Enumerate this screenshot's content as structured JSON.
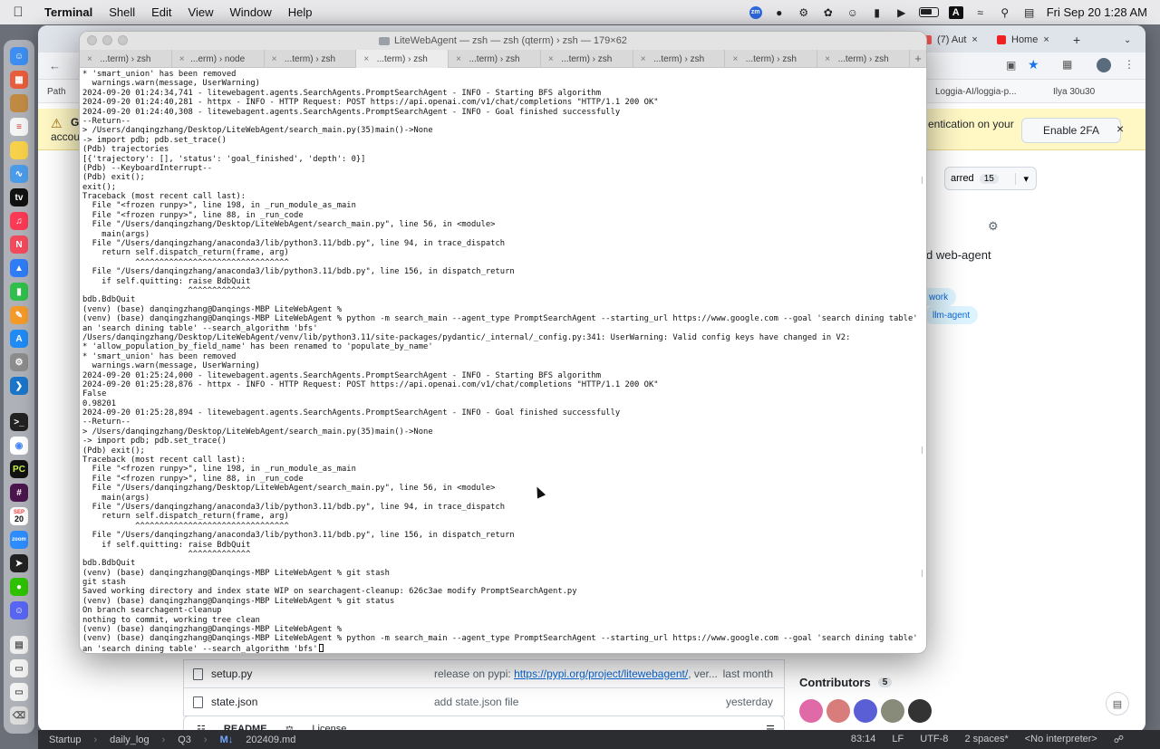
{
  "menubar": {
    "app_name": "Terminal",
    "items": [
      "Shell",
      "Edit",
      "View",
      "Window",
      "Help"
    ],
    "clock": "Fri Sep 20  1:28 AM",
    "tray_badge": "zm",
    "tray_letter": "A"
  },
  "dock": {
    "calendar_month": "SEP",
    "calendar_day": "20"
  },
  "browser": {
    "tabs": [
      {
        "label": "(7) Aut"
      },
      {
        "label": "Home"
      }
    ],
    "bookmarks": {
      "left": "Path",
      "loggia": "Loggia-AI/loggia-p...",
      "ilya": "Ilya 30u30"
    },
    "banner": {
      "partial_title": "G",
      "partial_sub": "accou",
      "partial_text": "entication on your",
      "button": "Enable 2FA"
    },
    "repo": {
      "starred_label": "arred",
      "starred_count": "15",
      "about_partial": "d web-agent",
      "topics": [
        "work",
        "llm-agent"
      ]
    },
    "files": [
      {
        "name": "setup.py",
        "message": "release on pypi: ",
        "link": "https://pypi.org/project/litewebagent/",
        "suffix": ", ver...",
        "date": "last month"
      },
      {
        "name": "state.json",
        "message": "add state.json file",
        "link": "",
        "suffix": "",
        "date": "yesterday"
      }
    ],
    "readme_tab": "README",
    "license_tab": "License",
    "contributors_label": "Contributors",
    "contributors_count": "5"
  },
  "terminal": {
    "title": "LiteWebAgent — zsh — zsh (qterm) › zsh — 179×62",
    "tabs": [
      {
        "label": "...term) › zsh",
        "active": false
      },
      {
        "label": "...erm) › node",
        "active": false
      },
      {
        "label": "...term) › zsh",
        "active": false
      },
      {
        "label": "...term) › zsh",
        "active": true
      },
      {
        "label": "...term) › zsh",
        "active": false
      },
      {
        "label": "...term) › zsh",
        "active": false
      },
      {
        "label": "...term) › zsh",
        "active": false
      },
      {
        "label": "...term) › zsh",
        "active": false
      },
      {
        "label": "...term) › zsh",
        "active": false
      }
    ],
    "lines": [
      "* 'smart_union' has been removed",
      "  warnings.warn(message, UserWarning)",
      "2024-09-20 01:24:34,741 - litewebagent.agents.SearchAgents.PromptSearchAgent - INFO - Starting BFS algorithm",
      "2024-09-20 01:24:40,281 - httpx - INFO - HTTP Request: POST https://api.openai.com/v1/chat/completions \"HTTP/1.1 200 OK\"",
      "2024-09-20 01:24:40,308 - litewebagent.agents.SearchAgents.PromptSearchAgent - INFO - Goal finished successfully",
      "--Return--",
      "> /Users/danqingzhang/Desktop/LiteWebAgent/search_main.py(35)main()->None",
      "-> import pdb; pdb.set_trace()",
      "(Pdb) trajectories",
      "[{'trajectory': [], 'status': 'goal_finished', 'depth': 0}]",
      "(Pdb) --KeyboardInterrupt--",
      "(Pdb) exit();",
      "exit();",
      "Traceback (most recent call last):",
      "  File \"<frozen runpy>\", line 198, in _run_module_as_main",
      "  File \"<frozen runpy>\", line 88, in _run_code",
      "  File \"/Users/danqingzhang/Desktop/LiteWebAgent/search_main.py\", line 56, in <module>",
      "    main(args)",
      "  File \"/Users/danqingzhang/anaconda3/lib/python3.11/bdb.py\", line 94, in trace_dispatch",
      "    return self.dispatch_return(frame, arg)",
      "           ^^^^^^^^^^^^^^^^^^^^^^^^^^^^^^^^",
      "  File \"/Users/danqingzhang/anaconda3/lib/python3.11/bdb.py\", line 156, in dispatch_return",
      "    if self.quitting: raise BdbQuit",
      "                      ^^^^^^^^^^^^^",
      "bdb.BdbQuit",
      "(venv) (base) danqingzhang@Danqings-MBP LiteWebAgent %",
      "(venv) (base) danqingzhang@Danqings-MBP LiteWebAgent % python -m search_main --agent_type PromptSearchAgent --starting_url https://www.google.com --goal 'search dining table' --pl",
      "an 'search dining table' --search_algorithm 'bfs'",
      "/Users/danqingzhang/Desktop/LiteWebAgent/venv/lib/python3.11/site-packages/pydantic/_internal/_config.py:341: UserWarning: Valid config keys have changed in V2:",
      "* 'allow_population_by_field_name' has been renamed to 'populate_by_name'",
      "* 'smart_union' has been removed",
      "  warnings.warn(message, UserWarning)",
      "2024-09-20 01:25:24,000 - litewebagent.agents.SearchAgents.PromptSearchAgent - INFO - Starting BFS algorithm",
      "2024-09-20 01:25:28,876 - httpx - INFO - HTTP Request: POST https://api.openai.com/v1/chat/completions \"HTTP/1.1 200 OK\"",
      "False",
      "0.98201",
      "2024-09-20 01:25:28,894 - litewebagent.agents.SearchAgents.PromptSearchAgent - INFO - Goal finished successfully",
      "--Return--",
      "> /Users/danqingzhang/Desktop/LiteWebAgent/search_main.py(35)main()->None",
      "-> import pdb; pdb.set_trace()",
      "(Pdb) exit();",
      "Traceback (most recent call last):",
      "  File \"<frozen runpy>\", line 198, in _run_module_as_main",
      "  File \"<frozen runpy>\", line 88, in _run_code",
      "  File \"/Users/danqingzhang/Desktop/LiteWebAgent/search_main.py\", line 56, in <module>",
      "    main(args)",
      "  File \"/Users/danqingzhang/anaconda3/lib/python3.11/bdb.py\", line 94, in trace_dispatch",
      "    return self.dispatch_return(frame, arg)",
      "           ^^^^^^^^^^^^^^^^^^^^^^^^^^^^^^^^",
      "  File \"/Users/danqingzhang/anaconda3/lib/python3.11/bdb.py\", line 156, in dispatch_return",
      "    if self.quitting: raise BdbQuit",
      "                      ^^^^^^^^^^^^^",
      "bdb.BdbQuit",
      "(venv) (base) danqingzhang@Danqings-MBP LiteWebAgent % git stash",
      "git stash",
      "Saved working directory and index state WIP on searchagent-cleanup: 626c3ae modify PromptSearchAgent.py",
      "(venv) (base) danqingzhang@Danqings-MBP LiteWebAgent % git status",
      "On branch searchagent-cleanup",
      "nothing to commit, working tree clean",
      "(venv) (base) danqingzhang@Danqings-MBP LiteWebAgent %",
      "(venv) (base) danqingzhang@Danqings-MBP LiteWebAgent % python -m search_main --agent_type PromptSearchAgent --starting_url https://www.google.com --goal 'search dining table' --pl",
      "an 'search dining table' --search_algorithm 'bfs'"
    ]
  },
  "statusbar": {
    "crumbs": [
      "Startup",
      "daily_log",
      "Q3",
      "202409.md"
    ],
    "md_badge": "M↓",
    "position": "83:14",
    "line_ending": "LF",
    "encoding": "UTF-8",
    "indent": "2 spaces*",
    "interpreter": "<No interpreter>"
  }
}
